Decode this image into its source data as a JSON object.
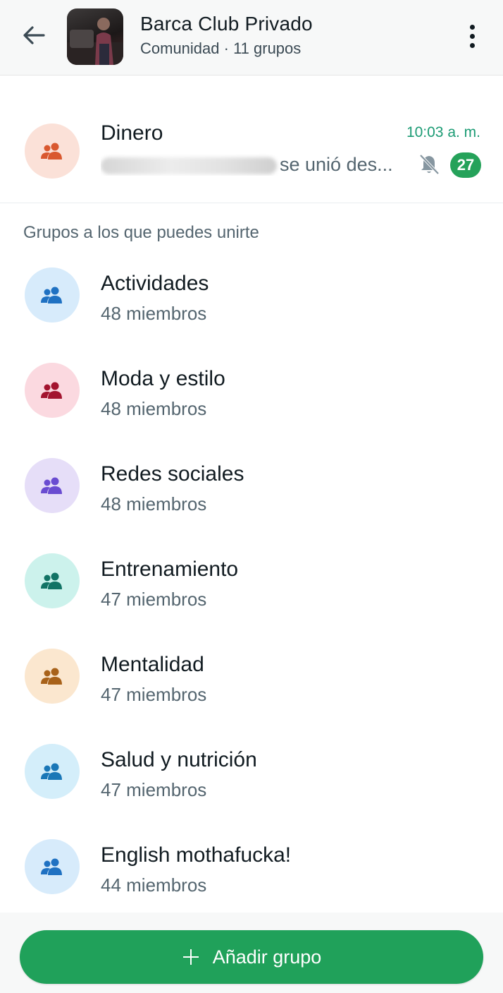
{
  "header": {
    "title": "Barca Club Privado",
    "subtitle": "Comunidad · 11 grupos",
    "back_icon": "arrow-left-icon",
    "menu_icon": "more-vert-icon"
  },
  "chat": {
    "name": "Dinero",
    "time": "10:03 a. m.",
    "message_visible": "se unió des...",
    "unread_count": "27",
    "muted_icon": "bell-off-icon",
    "avatar_color": "#fbe1d8",
    "icon_color": "#d9582f"
  },
  "section_label": "Grupos a los que puedes unirte",
  "groups": [
    {
      "name": "Actividades",
      "members": "48 miembros",
      "bg": "#d7ebfb",
      "fg": "#1f71c2"
    },
    {
      "name": "Moda y estilo",
      "members": "48 miembros",
      "bg": "#fbd9e0",
      "fg": "#a3142f"
    },
    {
      "name": "Redes sociales",
      "members": "48 miembros",
      "bg": "#e6def8",
      "fg": "#6a4cd1"
    },
    {
      "name": "Entrenamiento",
      "members": "47 miembros",
      "bg": "#ccf2ec",
      "fg": "#127365"
    },
    {
      "name": "Mentalidad",
      "members": "47 miembros",
      "bg": "#fbe7cf",
      "fg": "#a8621a"
    },
    {
      "name": "Salud y nutrición",
      "members": "47 miembros",
      "bg": "#d4eefa",
      "fg": "#1a77b7"
    },
    {
      "name": "English mothafucka!",
      "members": "44 miembros",
      "bg": "#d7ebfb",
      "fg": "#1f71c2"
    }
  ],
  "add_button": {
    "label": "Añadir grupo",
    "icon": "plus-icon"
  },
  "colors": {
    "accent": "#20a15a",
    "time_green": "#1b9b74"
  }
}
